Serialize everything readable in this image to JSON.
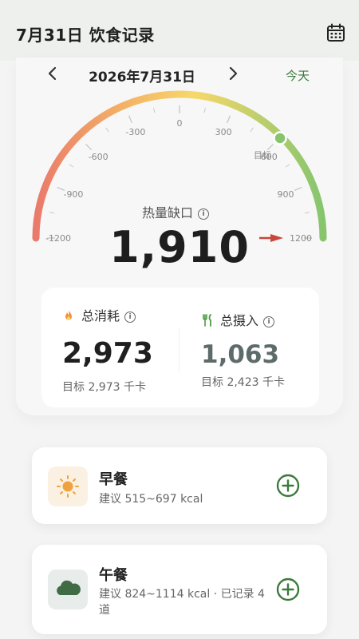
{
  "header": {
    "title": "7月31日 饮食记录",
    "calendar_icon": "calendar-icon"
  },
  "date_nav": {
    "date": "2026年7月31日",
    "today_label": "今天"
  },
  "gauge": {
    "tick_labels": [
      "-1200",
      "-900",
      "-600",
      "-300",
      "0",
      "300",
      "600",
      "900",
      "1200"
    ],
    "target_label": "目标",
    "current_marker_value": 600,
    "arrow_marker_value": 1200,
    "gradient": [
      "#ea7a6b",
      "#f3b166",
      "#f7d86a",
      "#86c56e"
    ]
  },
  "deficit": {
    "label": "热量缺口",
    "value": "1,910"
  },
  "stats": {
    "burned": {
      "label": "总消耗",
      "value": "2,973",
      "sub": "目标 2,973 千卡",
      "icon": "flame-icon"
    },
    "intake": {
      "label": "总摄入",
      "value": "1,063",
      "sub": "目标 2,423 千卡",
      "icon": "utensils-icon"
    }
  },
  "meals": [
    {
      "name": "早餐",
      "suggest": "建议 515~697 kcal",
      "icon": "sun-icon"
    },
    {
      "name": "午餐",
      "suggest": "建议 824~1114 kcal · 已记录 4 道",
      "icon": "cloud-icon"
    }
  ],
  "colors": {
    "accent_green": "#3c7a3c",
    "deficit_arrow": "#c9463d"
  }
}
